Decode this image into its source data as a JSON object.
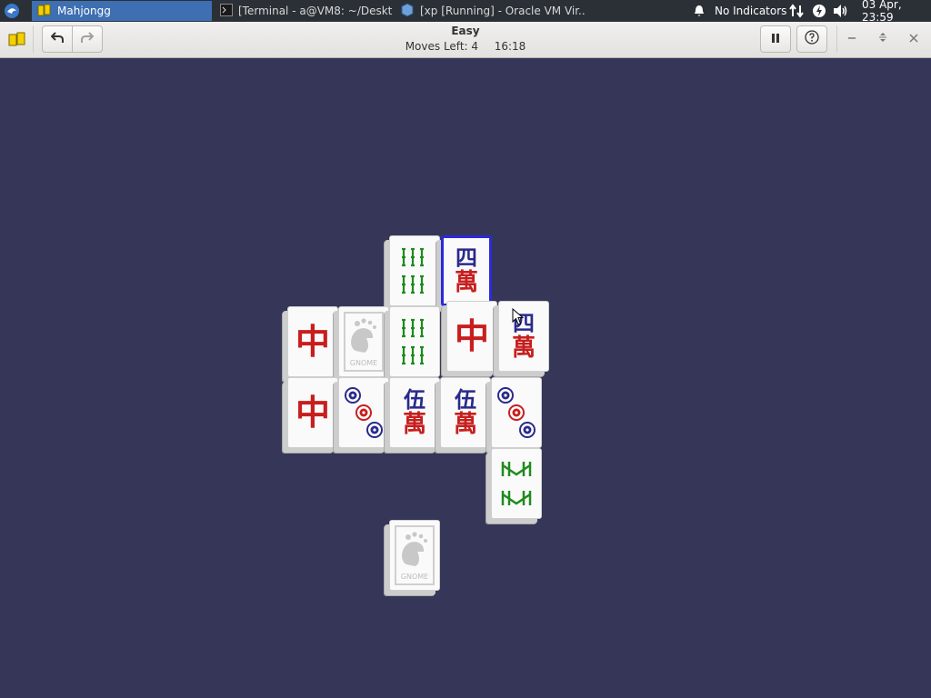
{
  "taskbar": {
    "tasks": [
      {
        "label": "Mahjongg"
      },
      {
        "label": "[Terminal - a@VM8: ~/Deskt..."
      },
      {
        "label": "[xp [Running] - Oracle VM Vir..."
      }
    ],
    "indicators_label": "No Indicators",
    "clock": "03 Apr, 23:59"
  },
  "header": {
    "title": "Easy",
    "moves_label": "Moves Left:",
    "moves_left": "4",
    "time": "16:18"
  },
  "colors": {
    "board_bg": "#363659",
    "selected_border": "#2a2ad6",
    "red": "#c81e1e",
    "blue": "#2a2a8c",
    "green": "#1e8c1e"
  },
  "tiles": [
    {
      "id": "bamboo-6-top",
      "kind": "bamboo",
      "selected": false
    },
    {
      "id": "character-4-top",
      "kind": "character",
      "chars": [
        "四",
        "萬"
      ],
      "selected": true
    },
    {
      "id": "red-dragon-1",
      "kind": "dragon",
      "chars": [
        "中"
      ],
      "selected": false
    },
    {
      "id": "gnome-1",
      "kind": "gnome",
      "text": "GNOME",
      "selected": false
    },
    {
      "id": "bamboo-6-mid",
      "kind": "bamboo",
      "selected": false
    },
    {
      "id": "red-dragon-2",
      "kind": "dragon",
      "chars": [
        "中"
      ],
      "selected": false
    },
    {
      "id": "character-4-mid",
      "kind": "character",
      "chars": [
        "四",
        "萬"
      ],
      "selected": false
    },
    {
      "id": "red-dragon-3",
      "kind": "dragon",
      "chars": [
        "中"
      ],
      "selected": false
    },
    {
      "id": "circle-3-a",
      "kind": "circle",
      "selected": false
    },
    {
      "id": "character-5-a",
      "kind": "character",
      "chars": [
        "伍",
        "萬"
      ],
      "selected": false
    },
    {
      "id": "character-5-b",
      "kind": "character",
      "chars": [
        "伍",
        "萬"
      ],
      "selected": false
    },
    {
      "id": "circle-3-b",
      "kind": "circle",
      "selected": false
    },
    {
      "id": "bamboo-flower",
      "kind": "bamboo-alt",
      "selected": false
    },
    {
      "id": "gnome-2",
      "kind": "gnome",
      "text": "GNOME",
      "selected": false
    }
  ]
}
